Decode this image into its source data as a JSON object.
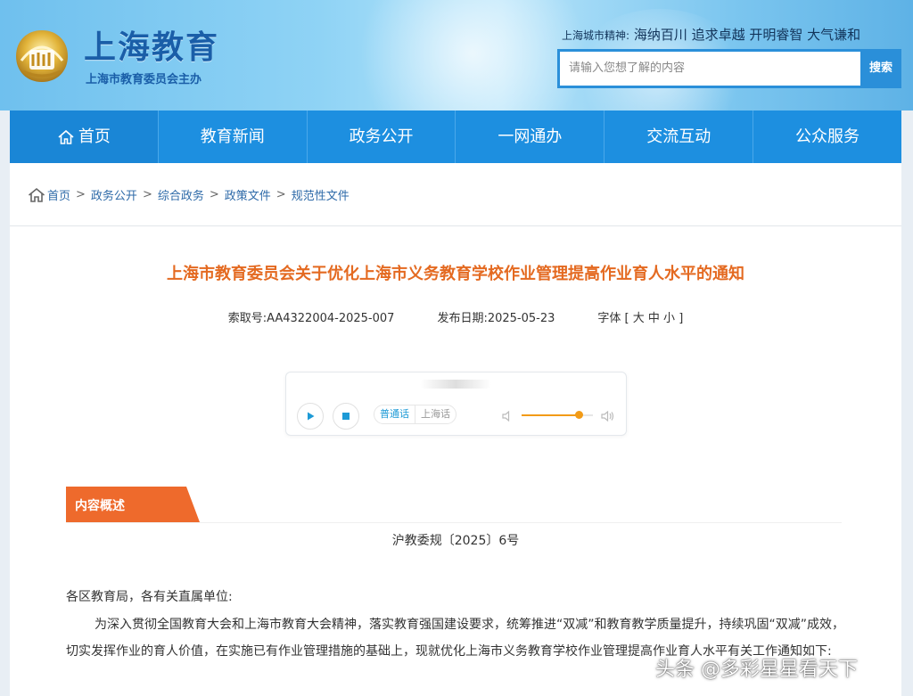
{
  "header": {
    "site_title": "上海教育",
    "site_subtitle": "上海市教育委员会主办",
    "spirit_label": "上海城市精神:",
    "spirit_text": "海纳百川 追求卓越 开明睿智 大气谦和",
    "search_placeholder": "请输入您想了解的内容",
    "search_button": "搜索"
  },
  "nav": {
    "items": [
      {
        "label": "首页",
        "icon": "home-icon"
      },
      {
        "label": "教育新闻"
      },
      {
        "label": "政务公开"
      },
      {
        "label": "一网通办"
      },
      {
        "label": "交流互动"
      },
      {
        "label": "公众服务"
      }
    ]
  },
  "breadcrumb": [
    "首页",
    "政务公开",
    "综合政务",
    "政策文件",
    "规范性文件"
  ],
  "article": {
    "title": "上海市教育委员会关于优化上海市义务教育学校作业管理提高作业育人水平的通知",
    "index_no": "索取号:AA4322004-2025-007",
    "publish_date": "发布日期:2025-05-23",
    "font_label": "字体",
    "font_sizes": [
      "大",
      "中",
      "小"
    ],
    "section_tag": "内容概述",
    "doc_no": "沪教委规〔2025〕6号",
    "greeting": "各区教育局，各有关直属单位:",
    "body": "为深入贯彻全国教育大会和上海市教育大会精神，落实教育强国建设要求，统筹推进“双减”和教育教学质量提升，持续巩固“双减”成效，切实发挥作业的育人价值，在实施已有作业管理措施的基础上，现就优化上海市义务教育学校作业管理提高作业育人水平有关工作通知如下:"
  },
  "player": {
    "lang_mandarin": "普通话",
    "lang_shanghai": "上海话",
    "active_lang": "普通话",
    "volume": 0.8
  },
  "watermark": "头条 @多彩星星看天下",
  "colors": {
    "nav_blue": "#1d8fe0",
    "title_orange": "#e46a21",
    "tag_orange": "#ee6a2c",
    "link_blue": "#2e6aa8"
  }
}
